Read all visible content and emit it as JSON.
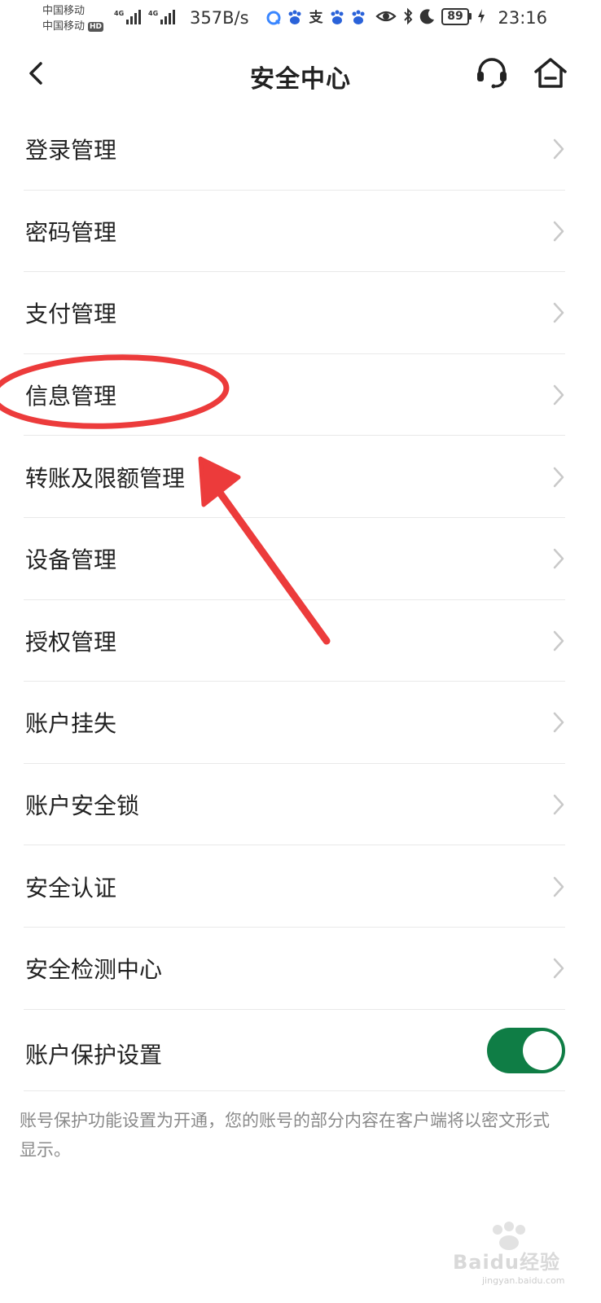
{
  "status_bar": {
    "carrier_1": "中国移动",
    "carrier_2": "中国移动",
    "hd": "HD",
    "net_type_1": "4G",
    "net_type_2": "4G",
    "net_speed": "357B/s",
    "battery": "89",
    "time": "23:16"
  },
  "header": {
    "title": "安全中心"
  },
  "menu": {
    "items": [
      {
        "label": "登录管理"
      },
      {
        "label": "密码管理"
      },
      {
        "label": "支付管理"
      },
      {
        "label": "信息管理"
      },
      {
        "label": "转账及限额管理"
      },
      {
        "label": "设备管理"
      },
      {
        "label": "授权管理"
      },
      {
        "label": "账户挂失"
      },
      {
        "label": "账户安全锁"
      },
      {
        "label": "安全认证"
      },
      {
        "label": "安全检测中心"
      }
    ],
    "protection": {
      "label": "账户保护设置",
      "enabled": true
    }
  },
  "note": "账号保护功能设置为开通，您的账号的部分内容在客户端将以密文形式显示。",
  "watermark": {
    "text": "Baidu经验",
    "sub": "jingyan.baidu.com"
  },
  "colors": {
    "toggle_on": "#0f7d45",
    "annotation": "#ec3b3b",
    "divider": "#e9e9e9"
  }
}
